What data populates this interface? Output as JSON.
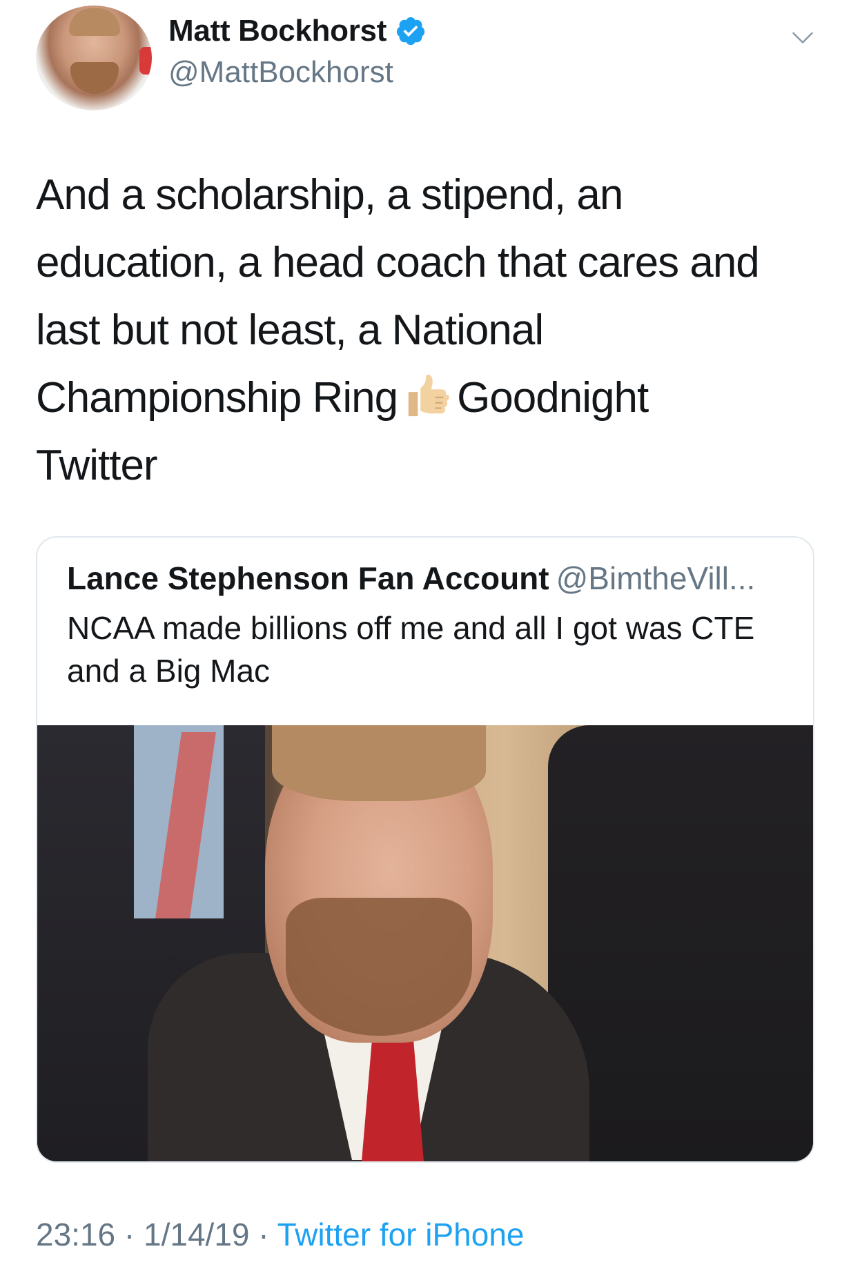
{
  "author": {
    "name": "Matt Bockhorst",
    "handle": "@MattBockhorst",
    "verified": true
  },
  "tweet": {
    "text_part1": "And a scholarship, a stipend, an\neducation, a head coach that cares and\nlast but not least, a National\nChampionship Ring",
    "emoji": "thumbs-up-light-skin-tone",
    "text_part2": "Goodnight\nTwitter"
  },
  "quoted_tweet": {
    "name": "Lance Stephenson Fan Account",
    "handle": "@BimtheVill...",
    "text": "NCAA made billions off me and all I got was CTE and a Big Mac"
  },
  "meta": {
    "time": "23:16",
    "separator": " · ",
    "date": "1/14/19",
    "source": "Twitter for iPhone"
  },
  "colors": {
    "accent": "#1da1f2",
    "secondary_text": "#657786",
    "primary_text": "#14171a",
    "border": "#e1e8ed"
  },
  "icons": [
    "verified-badge-icon",
    "chevron-down-icon",
    "thumbs-up-emoji"
  ]
}
